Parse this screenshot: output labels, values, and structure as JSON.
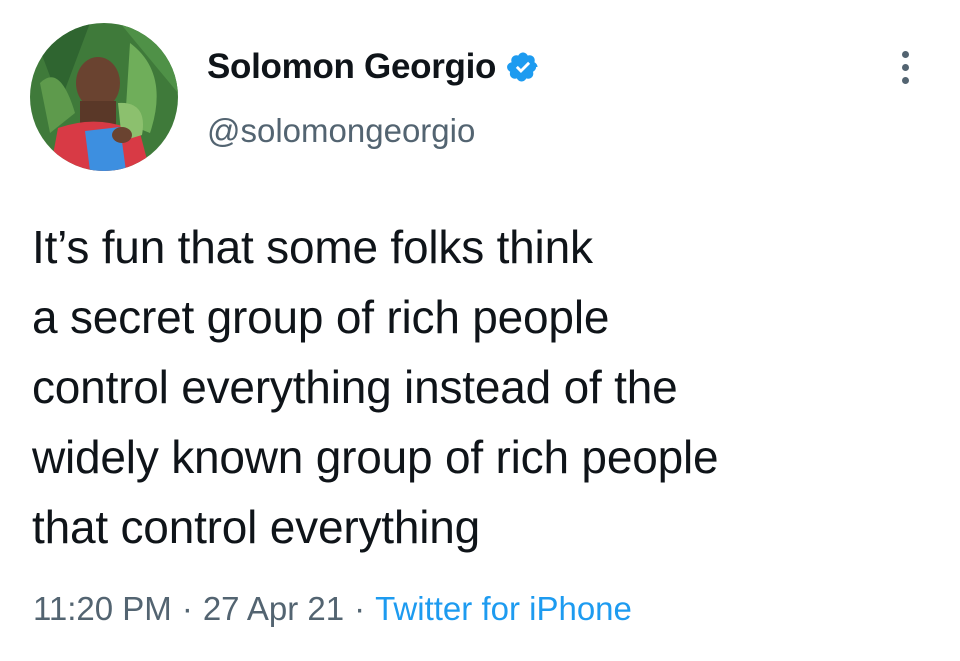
{
  "tweet": {
    "author": {
      "display_name": "Solomon Georgio",
      "handle": "@solomongeorgio",
      "verified": true,
      "avatar_icon": "profile-photo"
    },
    "text_lines": [
      "It’s fun that some folks think",
      "a secret group of rich people",
      "control everything instead of the",
      "widely known group of rich people",
      "that control everything"
    ],
    "meta": {
      "time": "11:20 PM",
      "separator": "·",
      "date": "27 Apr 21",
      "source": "Twitter for iPhone"
    },
    "more_icon": "more-vertical-icon"
  },
  "colors": {
    "text": "#0f1419",
    "secondary": "#536471",
    "accent": "#1d9bf0"
  }
}
